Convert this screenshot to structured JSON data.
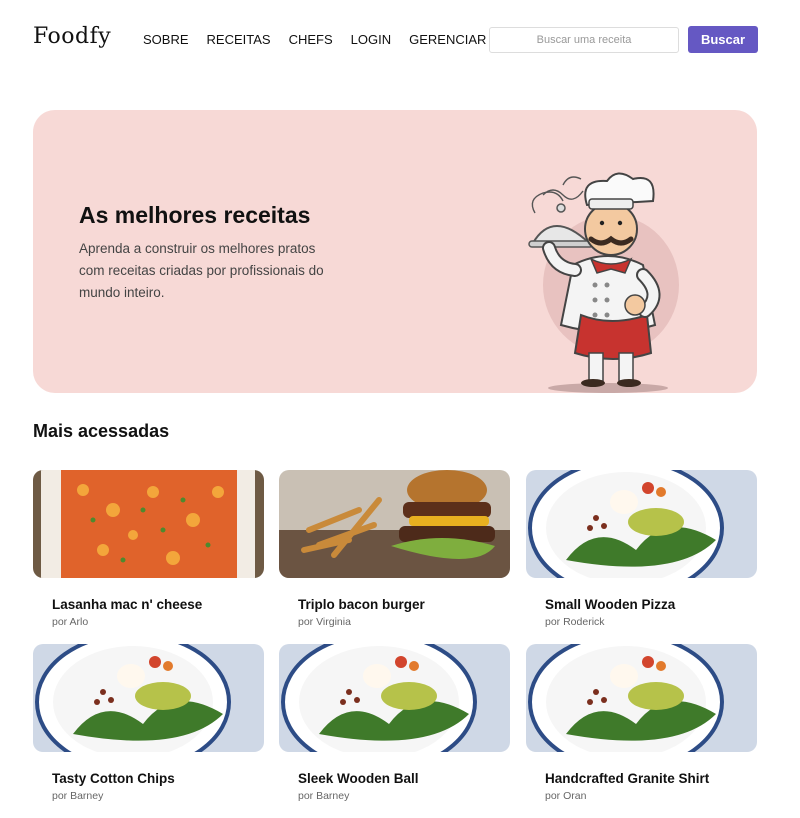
{
  "header": {
    "logo": "Foodfy",
    "nav": [
      "SOBRE",
      "RECEITAS",
      "CHEFS",
      "LOGIN",
      "GERENCIAR"
    ],
    "search_placeholder": "Buscar uma receita",
    "search_button": "Buscar"
  },
  "hero": {
    "title": "As melhores receitas",
    "text": "Aprenda a construir os melhores pratos com receitas criadas por profissionais do mundo inteiro."
  },
  "section": {
    "title": "Mais acessadas"
  },
  "recipes": [
    {
      "title": "Lasanha mac n' cheese",
      "author": "por Arlo",
      "image": "lasagna"
    },
    {
      "title": "Triplo bacon burger",
      "author": "por Virginia",
      "image": "burger"
    },
    {
      "title": "Small Wooden Pizza",
      "author": "por Roderick",
      "image": "salad"
    },
    {
      "title": "Tasty Cotton Chips",
      "author": "por Barney",
      "image": "salad"
    },
    {
      "title": "Sleek Wooden Ball",
      "author": "por Barney",
      "image": "salad"
    },
    {
      "title": "Handcrafted Granite Shirt",
      "author": "por Oran",
      "image": "salad"
    }
  ],
  "colors": {
    "accent": "#6558c3",
    "hero_bg": "#f7d9d6"
  }
}
